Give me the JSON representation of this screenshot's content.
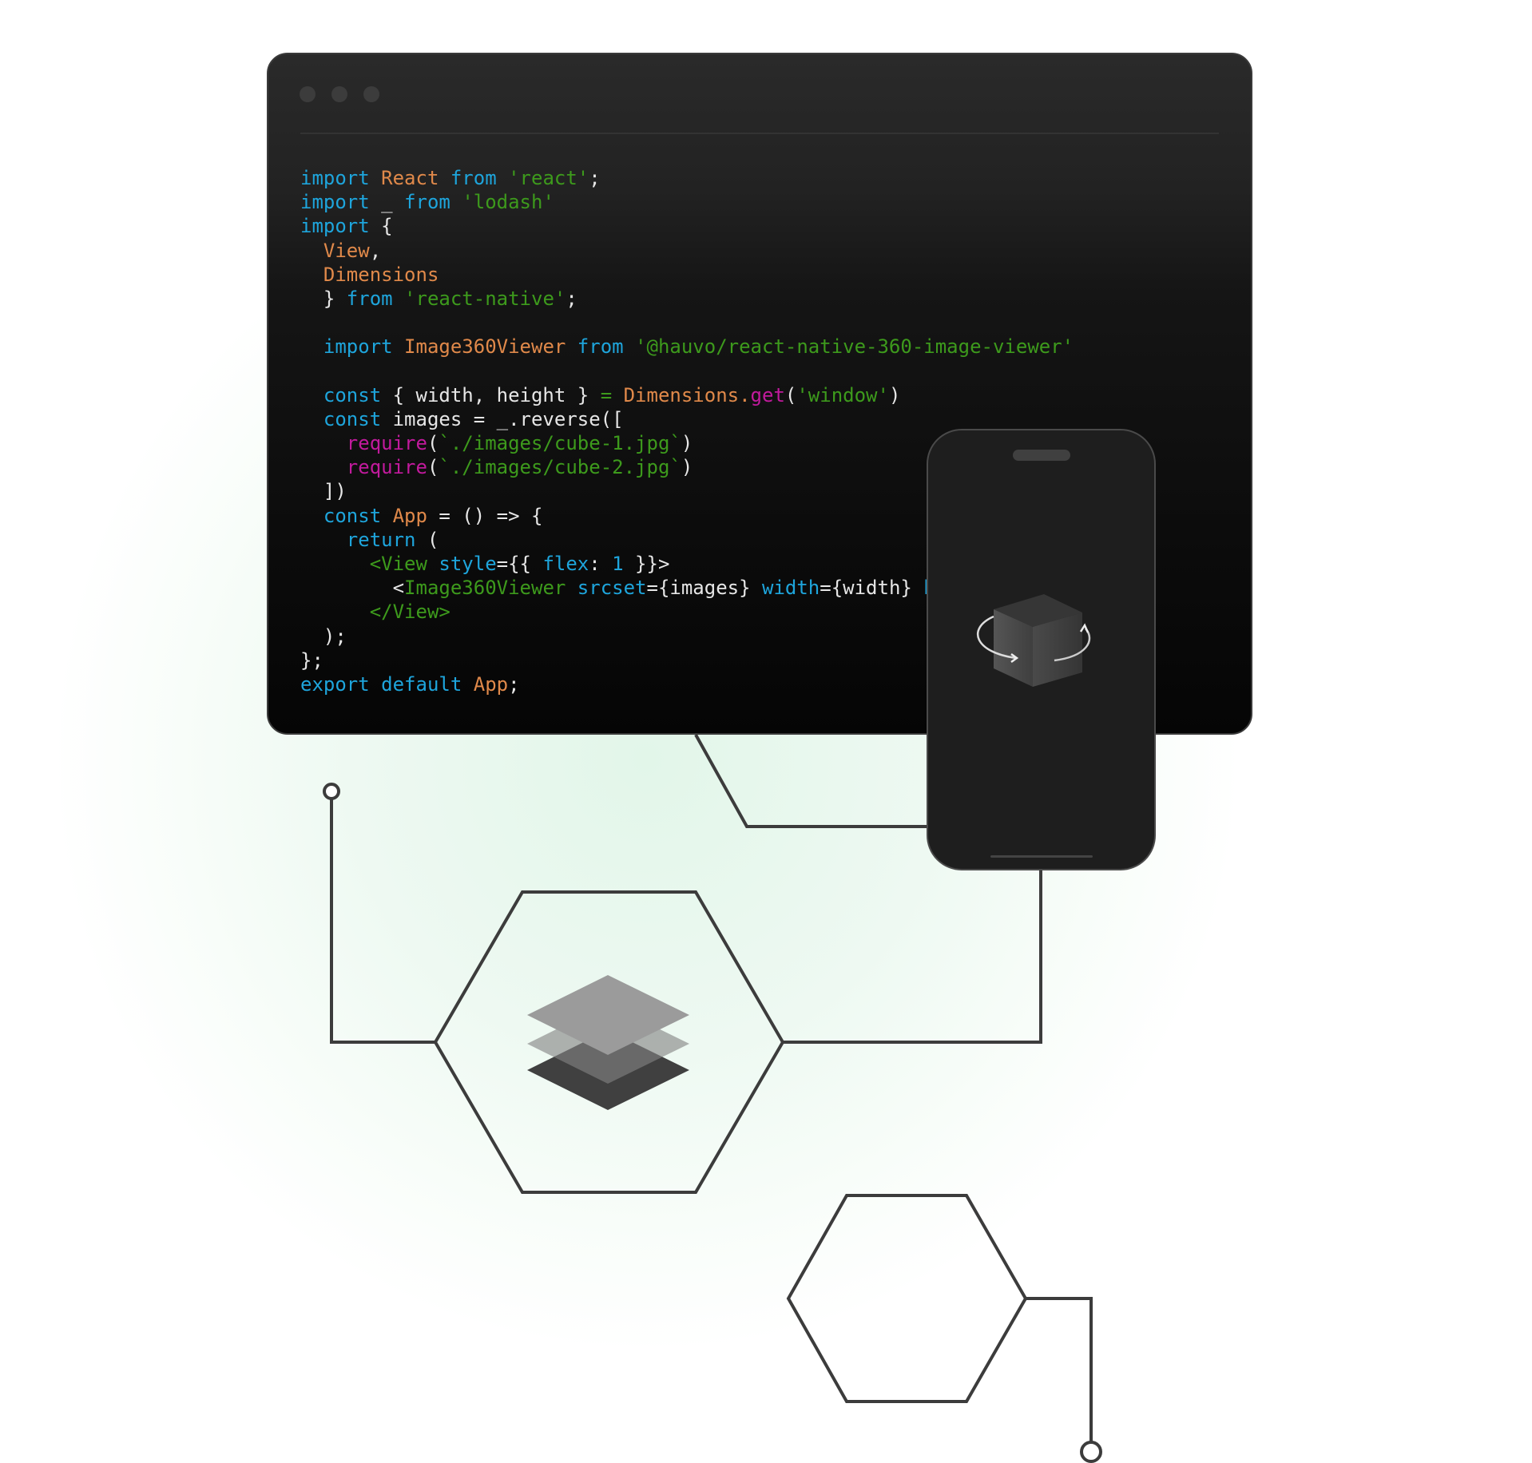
{
  "editor": {
    "window_dots": [
      "close",
      "minimize",
      "maximize"
    ],
    "code_lines": [
      [
        [
          "import ",
          "kw"
        ],
        [
          "React ",
          "id"
        ],
        [
          "from ",
          "kw"
        ],
        [
          "'react'",
          "str"
        ],
        [
          ";",
          "pl"
        ]
      ],
      [
        [
          "import ",
          "kw"
        ],
        [
          "_ ",
          "pl"
        ],
        [
          "from ",
          "kw"
        ],
        [
          "'lodash'",
          "str"
        ]
      ],
      [
        [
          "import ",
          "kw"
        ],
        [
          "{",
          "pl"
        ]
      ],
      [
        [
          "  View",
          "id"
        ],
        [
          ",",
          "pl"
        ]
      ],
      [
        [
          "  Dimensions",
          "id"
        ]
      ],
      [
        [
          "  } ",
          "pl"
        ],
        [
          "from ",
          "kw"
        ],
        [
          "'react-native'",
          "str"
        ],
        [
          ";",
          "pl"
        ]
      ],
      [],
      [
        [
          "  import ",
          "kw"
        ],
        [
          "Image360Viewer ",
          "id"
        ],
        [
          "from ",
          "kw"
        ],
        [
          "'@hauvo/react-native-360-image-viewer'",
          "str"
        ]
      ],
      [],
      [
        [
          "  const ",
          "kw"
        ],
        [
          "{ width, height } ",
          "pl"
        ],
        [
          "= ",
          "str"
        ],
        [
          "Dimensions.",
          "id"
        ],
        [
          "get",
          "fn"
        ],
        [
          "(",
          "pl"
        ],
        [
          "'window'",
          "str"
        ],
        [
          ")",
          "pl"
        ]
      ],
      [
        [
          "  const ",
          "kw"
        ],
        [
          "images = _.reverse([",
          "pl"
        ]
      ],
      [
        [
          "    require",
          "fn"
        ],
        [
          "(",
          "pl"
        ],
        [
          "`./images/cube-1.jpg`",
          "str"
        ],
        [
          ")",
          "pl"
        ]
      ],
      [
        [
          "    require",
          "fn"
        ],
        [
          "(",
          "pl"
        ],
        [
          "`./images/cube-2.jpg`",
          "str"
        ],
        [
          ")",
          "pl"
        ]
      ],
      [
        [
          "  ])",
          "pl"
        ]
      ],
      [
        [
          "  const ",
          "kw"
        ],
        [
          "App ",
          "id"
        ],
        [
          "= () => {",
          "pl"
        ]
      ],
      [
        [
          "    return ",
          "kw"
        ],
        [
          "(",
          "pl"
        ]
      ],
      [
        [
          "      <View ",
          "str"
        ],
        [
          "style",
          "kw"
        ],
        [
          "={{ ",
          "pl"
        ],
        [
          "flex",
          "kw"
        ],
        [
          ": ",
          "pl"
        ],
        [
          "1 ",
          "kw"
        ],
        [
          "}}>",
          "pl"
        ]
      ],
      [
        [
          "        <",
          "pl"
        ],
        [
          "Image360Viewer ",
          "str"
        ],
        [
          "srcset",
          "kw"
        ],
        [
          "={images} ",
          "pl"
        ],
        [
          "width",
          "kw"
        ],
        [
          "={width} ",
          "pl"
        ],
        [
          "h",
          "kw"
        ]
      ],
      [
        [
          "      </View>",
          "str"
        ]
      ],
      [
        [
          "  );",
          "pl"
        ]
      ],
      [
        [
          "};",
          "pl"
        ]
      ],
      [
        [
          "export ",
          "kw"
        ],
        [
          "default ",
          "kw"
        ],
        [
          "App",
          "id"
        ],
        [
          ";",
          "pl"
        ]
      ]
    ]
  },
  "phone": {
    "screen_icon": "rotating-cube-360-icon"
  },
  "diagram": {
    "hexagon_1_icon": "layers-icon",
    "hexagon_2_icon": "empty"
  },
  "colors": {
    "keyword": "#1ea5dc",
    "identifier": "#e0894a",
    "string": "#3d9a1c",
    "function": "#c21a9d",
    "line": "#3c3c3c",
    "glow": "#e2f6e9"
  }
}
